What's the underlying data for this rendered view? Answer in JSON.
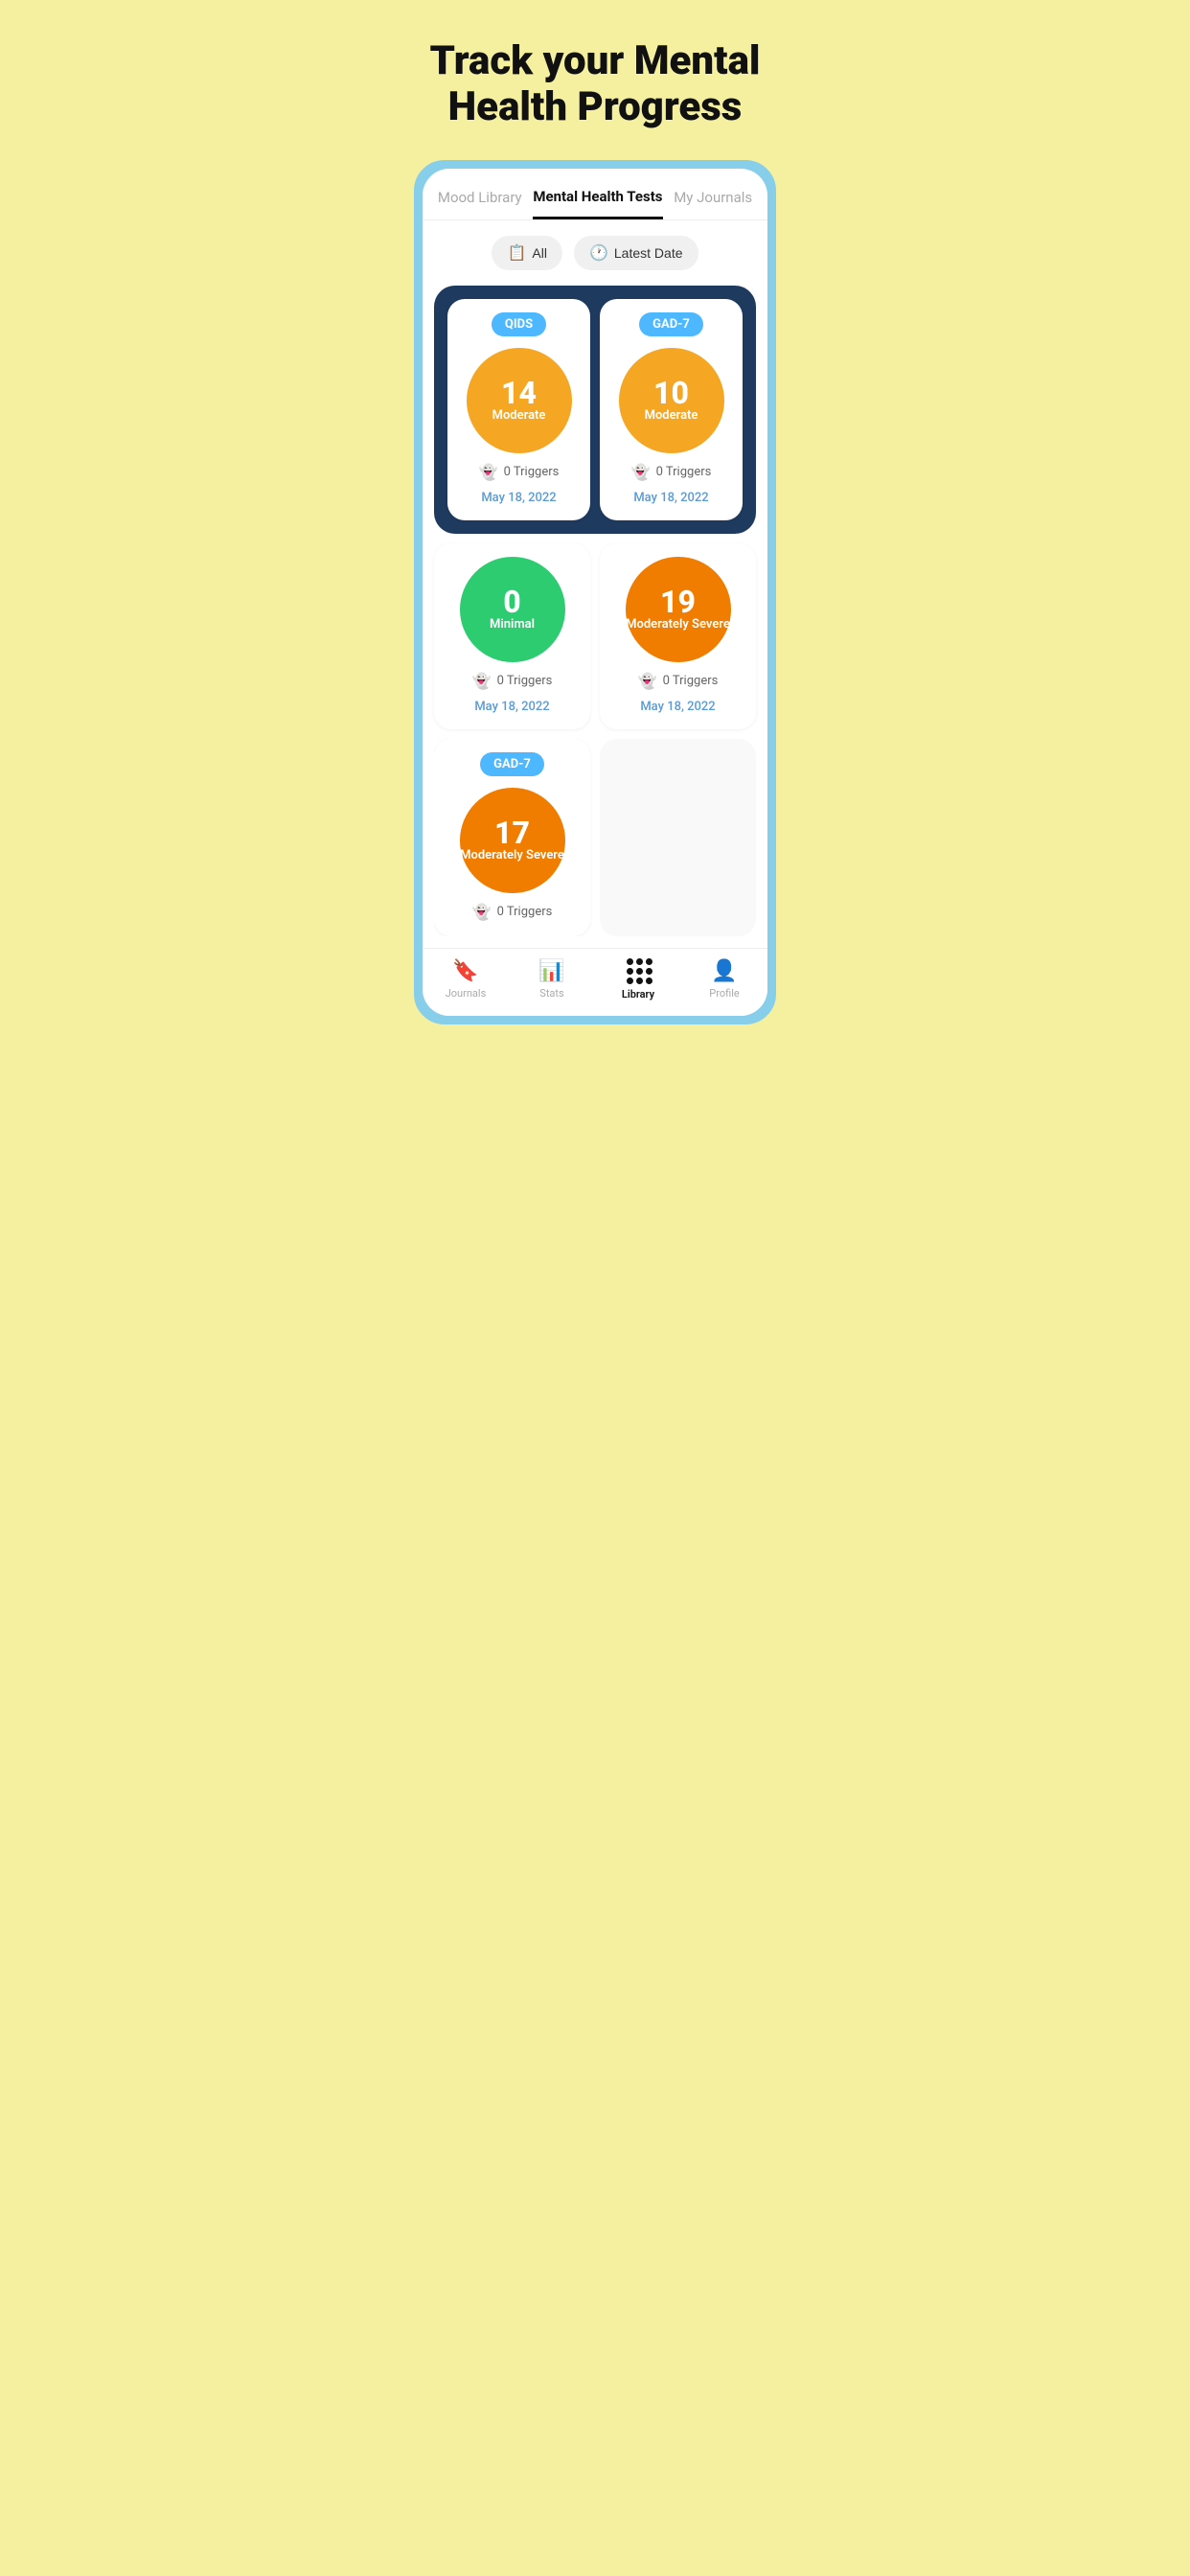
{
  "hero": {
    "title": "Track your Mental Health Progress"
  },
  "tabs": {
    "items": [
      {
        "id": "mood-library",
        "label": "Mood Library",
        "active": false
      },
      {
        "id": "mental-health-tests",
        "label": "Mental Health Tests",
        "active": true
      },
      {
        "id": "my-journals",
        "label": "My Journals",
        "active": false
      }
    ]
  },
  "filters": {
    "all_label": "All",
    "latest_date_label": "Latest Date"
  },
  "highlighted_cards": [
    {
      "badge": "QIDS",
      "score": "14",
      "severity": "Moderate",
      "triggers": "0 Triggers",
      "date": "May 18, 2022",
      "color": "orange"
    },
    {
      "badge": "GAD-7",
      "score": "10",
      "severity": "Moderate",
      "triggers": "0 Triggers",
      "date": "May 18, 2022",
      "color": "orange"
    }
  ],
  "regular_cards": [
    {
      "badge": "",
      "score": "0",
      "severity": "Minimal",
      "triggers": "0 Triggers",
      "date": "May 18, 2022",
      "color": "green"
    },
    {
      "badge": "",
      "score": "19",
      "severity": "Moderately Severe",
      "triggers": "0 Triggers",
      "date": "May 18, 2022",
      "color": "orange-dark"
    }
  ],
  "partial_cards": [
    {
      "badge": "GAD-7",
      "score": "17",
      "severity": "Moderately Severe",
      "triggers": "0 Triggers",
      "date": "",
      "color": "orange-dark"
    }
  ],
  "bottom_nav": {
    "items": [
      {
        "id": "journals",
        "label": "Journals",
        "icon": "bookmark",
        "active": false
      },
      {
        "id": "stats",
        "label": "Stats",
        "icon": "bar-chart",
        "active": false
      },
      {
        "id": "library",
        "label": "Library",
        "icon": "dots-grid",
        "active": true
      },
      {
        "id": "profile",
        "label": "Profile",
        "icon": "person",
        "active": false
      }
    ]
  }
}
